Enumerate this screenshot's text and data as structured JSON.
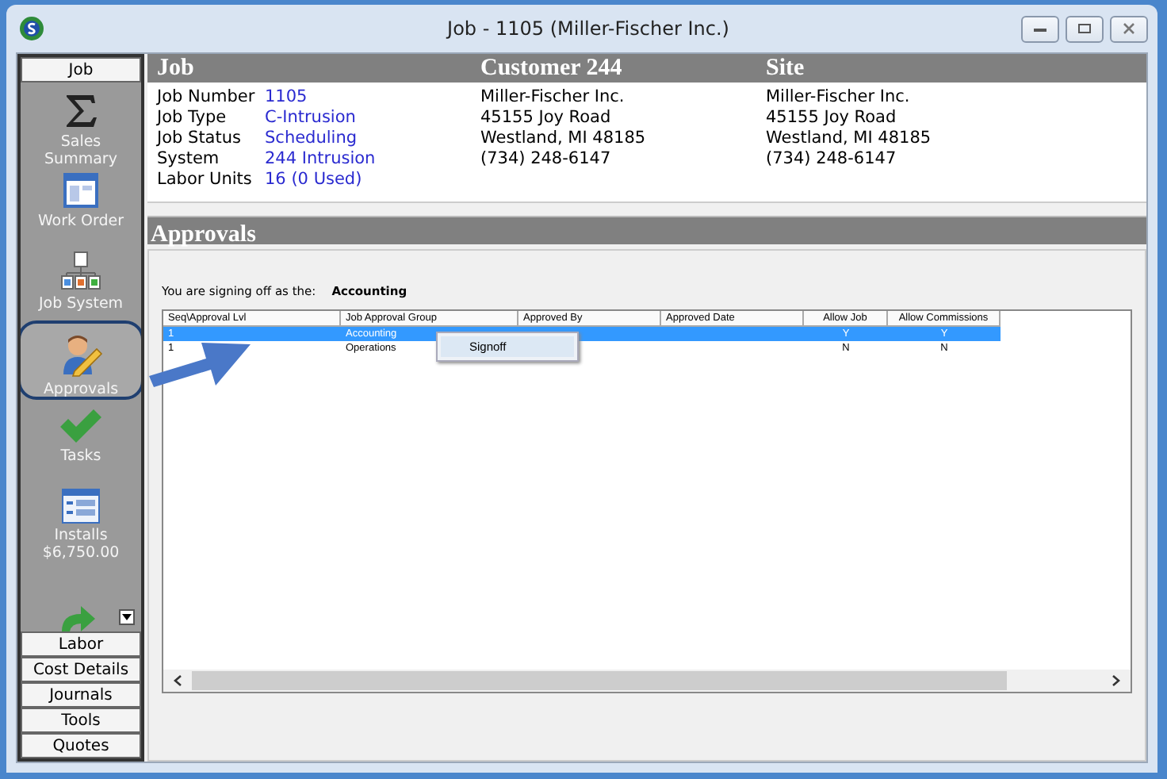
{
  "window": {
    "title": "Job - 1105 (Miller-Fischer Inc.)"
  },
  "sidebar": {
    "header": "Job",
    "items": [
      {
        "label": "Sales Summary",
        "selected": false
      },
      {
        "label": "Work Order",
        "selected": false
      },
      {
        "label": "Job System",
        "selected": false
      },
      {
        "label": "Approvals",
        "selected": true
      },
      {
        "label": "Tasks",
        "selected": false
      },
      {
        "label": "Installs",
        "sublabel": "$6,750.00",
        "selected": false
      }
    ],
    "nav_buttons": [
      "Labor",
      "Cost Details",
      "Journals",
      "Tools",
      "Quotes"
    ]
  },
  "header": {
    "columns": [
      "Job",
      "Customer 244",
      "Site"
    ]
  },
  "job": {
    "fields": [
      {
        "label": "Job Number",
        "value": "1105"
      },
      {
        "label": "Job Type",
        "value": "C-Intrusion"
      },
      {
        "label": "Job Status",
        "value": "Scheduling"
      },
      {
        "label": "System",
        "value": "244 Intrusion"
      },
      {
        "label": "Labor Units",
        "value": "16 (0 Used)"
      }
    ]
  },
  "customer": {
    "lines": [
      "Miller-Fischer Inc.",
      "45155 Joy Road",
      "Westland, MI  48185",
      "(734) 248-6147"
    ]
  },
  "site": {
    "lines": [
      "Miller-Fischer Inc.",
      "45155 Joy Road",
      "Westland, MI  48185",
      "(734) 248-6147"
    ]
  },
  "approvals": {
    "title": "Approvals",
    "signing_label": "You are signing off as the:",
    "signing_group": "Accounting",
    "table": {
      "columns": [
        "Seq\\Approval Lvl",
        "Job Approval Group",
        "Approved By",
        "Approved Date",
        "Allow Job",
        "Allow Commissions"
      ],
      "rows": [
        {
          "seq": "1",
          "group": "Accounting",
          "allow_job": "Y",
          "allow_commissions": "Y",
          "selected": true
        },
        {
          "seq": "1",
          "group": "Operations",
          "allow_job": "N",
          "allow_commissions": "N",
          "selected": false
        }
      ]
    },
    "context_menu": {
      "items": [
        "Signoff"
      ]
    }
  }
}
